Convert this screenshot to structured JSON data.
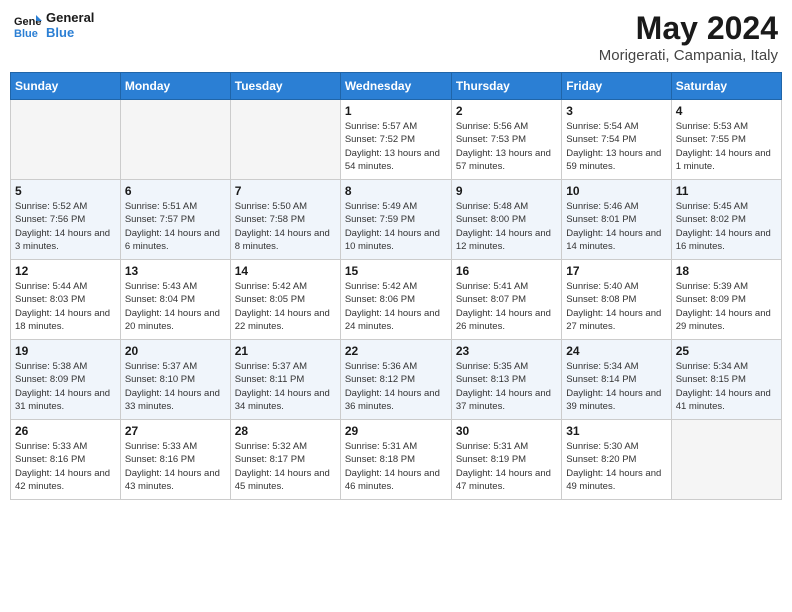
{
  "header": {
    "logo_line1": "General",
    "logo_line2": "Blue",
    "month_year": "May 2024",
    "location": "Morigerati, Campania, Italy"
  },
  "weekdays": [
    "Sunday",
    "Monday",
    "Tuesday",
    "Wednesday",
    "Thursday",
    "Friday",
    "Saturday"
  ],
  "weeks": [
    [
      {
        "day": "",
        "info": ""
      },
      {
        "day": "",
        "info": ""
      },
      {
        "day": "",
        "info": ""
      },
      {
        "day": "1",
        "info": "Sunrise: 5:57 AM\nSunset: 7:52 PM\nDaylight: 13 hours\nand 54 minutes."
      },
      {
        "day": "2",
        "info": "Sunrise: 5:56 AM\nSunset: 7:53 PM\nDaylight: 13 hours\nand 57 minutes."
      },
      {
        "day": "3",
        "info": "Sunrise: 5:54 AM\nSunset: 7:54 PM\nDaylight: 13 hours\nand 59 minutes."
      },
      {
        "day": "4",
        "info": "Sunrise: 5:53 AM\nSunset: 7:55 PM\nDaylight: 14 hours\nand 1 minute."
      }
    ],
    [
      {
        "day": "5",
        "info": "Sunrise: 5:52 AM\nSunset: 7:56 PM\nDaylight: 14 hours\nand 3 minutes."
      },
      {
        "day": "6",
        "info": "Sunrise: 5:51 AM\nSunset: 7:57 PM\nDaylight: 14 hours\nand 6 minutes."
      },
      {
        "day": "7",
        "info": "Sunrise: 5:50 AM\nSunset: 7:58 PM\nDaylight: 14 hours\nand 8 minutes."
      },
      {
        "day": "8",
        "info": "Sunrise: 5:49 AM\nSunset: 7:59 PM\nDaylight: 14 hours\nand 10 minutes."
      },
      {
        "day": "9",
        "info": "Sunrise: 5:48 AM\nSunset: 8:00 PM\nDaylight: 14 hours\nand 12 minutes."
      },
      {
        "day": "10",
        "info": "Sunrise: 5:46 AM\nSunset: 8:01 PM\nDaylight: 14 hours\nand 14 minutes."
      },
      {
        "day": "11",
        "info": "Sunrise: 5:45 AM\nSunset: 8:02 PM\nDaylight: 14 hours\nand 16 minutes."
      }
    ],
    [
      {
        "day": "12",
        "info": "Sunrise: 5:44 AM\nSunset: 8:03 PM\nDaylight: 14 hours\nand 18 minutes."
      },
      {
        "day": "13",
        "info": "Sunrise: 5:43 AM\nSunset: 8:04 PM\nDaylight: 14 hours\nand 20 minutes."
      },
      {
        "day": "14",
        "info": "Sunrise: 5:42 AM\nSunset: 8:05 PM\nDaylight: 14 hours\nand 22 minutes."
      },
      {
        "day": "15",
        "info": "Sunrise: 5:42 AM\nSunset: 8:06 PM\nDaylight: 14 hours\nand 24 minutes."
      },
      {
        "day": "16",
        "info": "Sunrise: 5:41 AM\nSunset: 8:07 PM\nDaylight: 14 hours\nand 26 minutes."
      },
      {
        "day": "17",
        "info": "Sunrise: 5:40 AM\nSunset: 8:08 PM\nDaylight: 14 hours\nand 27 minutes."
      },
      {
        "day": "18",
        "info": "Sunrise: 5:39 AM\nSunset: 8:09 PM\nDaylight: 14 hours\nand 29 minutes."
      }
    ],
    [
      {
        "day": "19",
        "info": "Sunrise: 5:38 AM\nSunset: 8:09 PM\nDaylight: 14 hours\nand 31 minutes."
      },
      {
        "day": "20",
        "info": "Sunrise: 5:37 AM\nSunset: 8:10 PM\nDaylight: 14 hours\nand 33 minutes."
      },
      {
        "day": "21",
        "info": "Sunrise: 5:37 AM\nSunset: 8:11 PM\nDaylight: 14 hours\nand 34 minutes."
      },
      {
        "day": "22",
        "info": "Sunrise: 5:36 AM\nSunset: 8:12 PM\nDaylight: 14 hours\nand 36 minutes."
      },
      {
        "day": "23",
        "info": "Sunrise: 5:35 AM\nSunset: 8:13 PM\nDaylight: 14 hours\nand 37 minutes."
      },
      {
        "day": "24",
        "info": "Sunrise: 5:34 AM\nSunset: 8:14 PM\nDaylight: 14 hours\nand 39 minutes."
      },
      {
        "day": "25",
        "info": "Sunrise: 5:34 AM\nSunset: 8:15 PM\nDaylight: 14 hours\nand 41 minutes."
      }
    ],
    [
      {
        "day": "26",
        "info": "Sunrise: 5:33 AM\nSunset: 8:16 PM\nDaylight: 14 hours\nand 42 minutes."
      },
      {
        "day": "27",
        "info": "Sunrise: 5:33 AM\nSunset: 8:16 PM\nDaylight: 14 hours\nand 43 minutes."
      },
      {
        "day": "28",
        "info": "Sunrise: 5:32 AM\nSunset: 8:17 PM\nDaylight: 14 hours\nand 45 minutes."
      },
      {
        "day": "29",
        "info": "Sunrise: 5:31 AM\nSunset: 8:18 PM\nDaylight: 14 hours\nand 46 minutes."
      },
      {
        "day": "30",
        "info": "Sunrise: 5:31 AM\nSunset: 8:19 PM\nDaylight: 14 hours\nand 47 minutes."
      },
      {
        "day": "31",
        "info": "Sunrise: 5:30 AM\nSunset: 8:20 PM\nDaylight: 14 hours\nand 49 minutes."
      },
      {
        "day": "",
        "info": ""
      }
    ]
  ]
}
